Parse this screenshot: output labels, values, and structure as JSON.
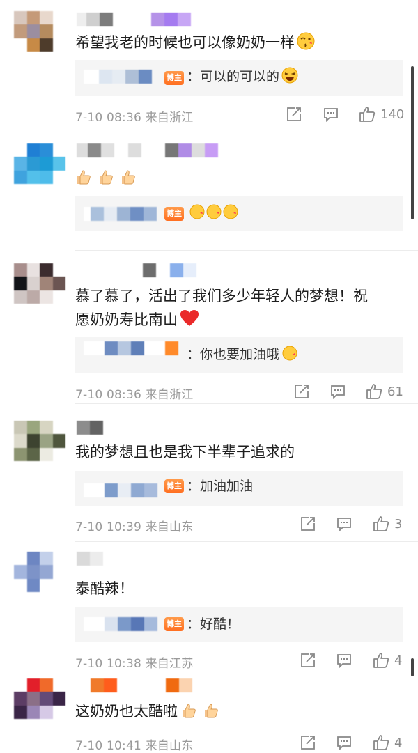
{
  "comments": [
    {
      "text": "希望我老的时候也可以像奶奶一样",
      "reply_author_badge": "博主",
      "reply_text": "：可以的可以的",
      "time": "7-10 08:36",
      "location": "来自浙江",
      "likes": "140"
    },
    {
      "text": "",
      "reply_author_badge": "博主",
      "reply_text": ""
    },
    {
      "text_line1": "慕了慕了，活出了我们多少年轻人的梦想！祝",
      "text_line2": "愿奶奶寿比南山",
      "reply_text": "：你也要加油哦",
      "time": "7-10 08:36",
      "location": "来自浙江",
      "likes": "61"
    },
    {
      "text": "我的梦想且也是我下半辈子追求的",
      "reply_author_badge": "博主",
      "reply_text": "：加油加油",
      "time": "7-10 10:39",
      "location": "来自山东",
      "likes": "3"
    },
    {
      "text": "泰酷辣！",
      "reply_author_badge": "博主",
      "reply_text": "：好酷！",
      "time": "7-10 10:38",
      "location": "来自江苏",
      "likes": "4"
    },
    {
      "text": "这奶奶也太酷啦",
      "time": "7-10 10:41",
      "location": "来自山东",
      "likes": "4"
    }
  ],
  "icons": {
    "share": "share-icon",
    "comment": "comment-icon",
    "like": "like-icon",
    "emoji_kiss": "kissing-face-emoji",
    "emoji_laugh": "laughing-face-emoji",
    "emoji_heart": "red-heart-emoji",
    "emoji_thumb": "thumbs-up-emoji"
  },
  "colors": {
    "badge": "#ff7a2b",
    "meta": "#9a9a9a",
    "reply_bg": "#f5f5f5"
  }
}
